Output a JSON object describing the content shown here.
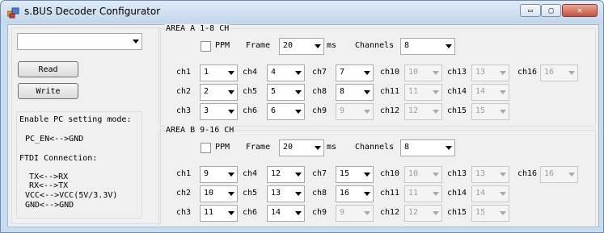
{
  "window": {
    "title": "s.BUS Decoder Configurator",
    "minimize_glyph": "▭",
    "maximize_glyph": "▢",
    "close_glyph": "✕"
  },
  "left": {
    "port_select_value": "",
    "read_label": "Read",
    "write_label": "Write",
    "info": {
      "heading": "Enable PC setting mode:",
      "pc_en": "PC_EN<-->GND",
      "ftdi_heading": "FTDI Connection:",
      "tx": "TX<-->RX",
      "rx": "RX<-->TX",
      "vcc": "VCC<-->VCC(5V/3.3V)",
      "gnd": "GND<-->GND"
    }
  },
  "areas": [
    {
      "title": "AREA A 1-8 CH",
      "ppm_label": "PPM",
      "frame_label": "Frame",
      "frame_value": "20",
      "frame_unit": "ms",
      "channels_label": "Channels",
      "channels_value": "8",
      "rows": [
        [
          {
            "label": "ch1",
            "value": "1",
            "enabled": true
          },
          {
            "label": "ch4",
            "value": "4",
            "enabled": true
          },
          {
            "label": "ch7",
            "value": "7",
            "enabled": true
          },
          {
            "label": "ch10",
            "value": "10",
            "enabled": false
          },
          {
            "label": "ch13",
            "value": "13",
            "enabled": false
          },
          {
            "label": "ch16",
            "value": "16",
            "enabled": false
          }
        ],
        [
          {
            "label": "ch2",
            "value": "2",
            "enabled": true
          },
          {
            "label": "ch5",
            "value": "5",
            "enabled": true
          },
          {
            "label": "ch8",
            "value": "8",
            "enabled": true
          },
          {
            "label": "ch11",
            "value": "11",
            "enabled": false
          },
          {
            "label": "ch14",
            "value": "14",
            "enabled": false
          }
        ],
        [
          {
            "label": "ch3",
            "value": "3",
            "enabled": true
          },
          {
            "label": "ch6",
            "value": "6",
            "enabled": true
          },
          {
            "label": "ch9",
            "value": "9",
            "enabled": false
          },
          {
            "label": "ch12",
            "value": "12",
            "enabled": false
          },
          {
            "label": "ch15",
            "value": "15",
            "enabled": false
          }
        ]
      ]
    },
    {
      "title": "AREA B 9-16 CH",
      "ppm_label": "PPM",
      "frame_label": "Frame",
      "frame_value": "20",
      "frame_unit": "ms",
      "channels_label": "Channels",
      "channels_value": "8",
      "rows": [
        [
          {
            "label": "ch1",
            "value": "9",
            "enabled": true
          },
          {
            "label": "ch4",
            "value": "12",
            "enabled": true
          },
          {
            "label": "ch7",
            "value": "15",
            "enabled": true
          },
          {
            "label": "ch10",
            "value": "10",
            "enabled": false
          },
          {
            "label": "ch13",
            "value": "13",
            "enabled": false
          },
          {
            "label": "ch16",
            "value": "16",
            "enabled": false
          }
        ],
        [
          {
            "label": "ch2",
            "value": "10",
            "enabled": true
          },
          {
            "label": "ch5",
            "value": "13",
            "enabled": true
          },
          {
            "label": "ch8",
            "value": "16",
            "enabled": true
          },
          {
            "label": "ch11",
            "value": "11",
            "enabled": false
          },
          {
            "label": "ch14",
            "value": "14",
            "enabled": false
          }
        ],
        [
          {
            "label": "ch3",
            "value": "11",
            "enabled": true
          },
          {
            "label": "ch6",
            "value": "14",
            "enabled": true
          },
          {
            "label": "ch9",
            "value": "9",
            "enabled": false
          },
          {
            "label": "ch12",
            "value": "12",
            "enabled": false
          },
          {
            "label": "ch15",
            "value": "15",
            "enabled": false
          }
        ]
      ]
    }
  ]
}
